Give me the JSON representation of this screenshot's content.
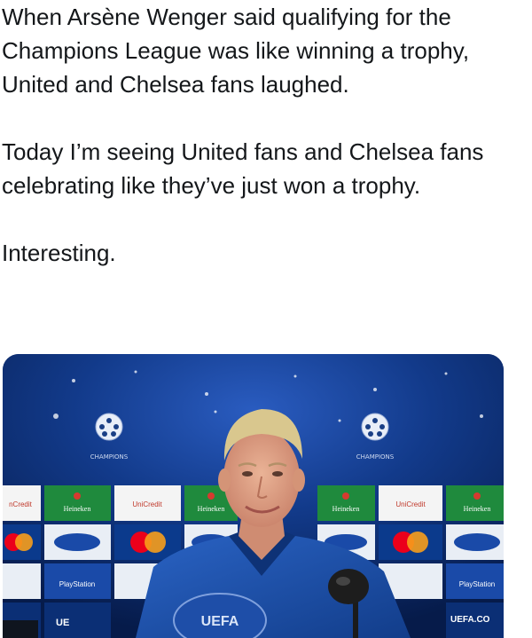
{
  "tweet": {
    "paragraphs": [
      "When Arsène Wenger said qualifying for the Champions League was like winning a trophy, United and Chelsea fans laughed.",
      "Today I’m seeing United fans and Chelsea fans celebrating like they’ve just won a trophy.",
      "Interesting."
    ]
  },
  "media": {
    "backdrop": {
      "sponsor_labels": [
        "UniCredit",
        "Heineken",
        "UniCredit",
        "Heineken",
        "Heineken",
        "UniCredit",
        "Heineken"
      ],
      "row2_labels": [
        "MasterCard",
        "Ford",
        "MasterCard",
        "Ford",
        "Ford",
        "MasterCard",
        "Ford"
      ],
      "row3_labels": [
        "PlayStation",
        "PlayStation"
      ],
      "logo_label": "CHAMPIONS LEAGUE",
      "bottom_left": "UE",
      "bottom_right": "UEFA.CO",
      "podium_text": "UEFA"
    },
    "colors": {
      "backdrop_blue": "#0c2f73",
      "shirt_blue": "#1b4fa8",
      "hair": "#d8c48a",
      "skin": "#e0a386"
    }
  }
}
